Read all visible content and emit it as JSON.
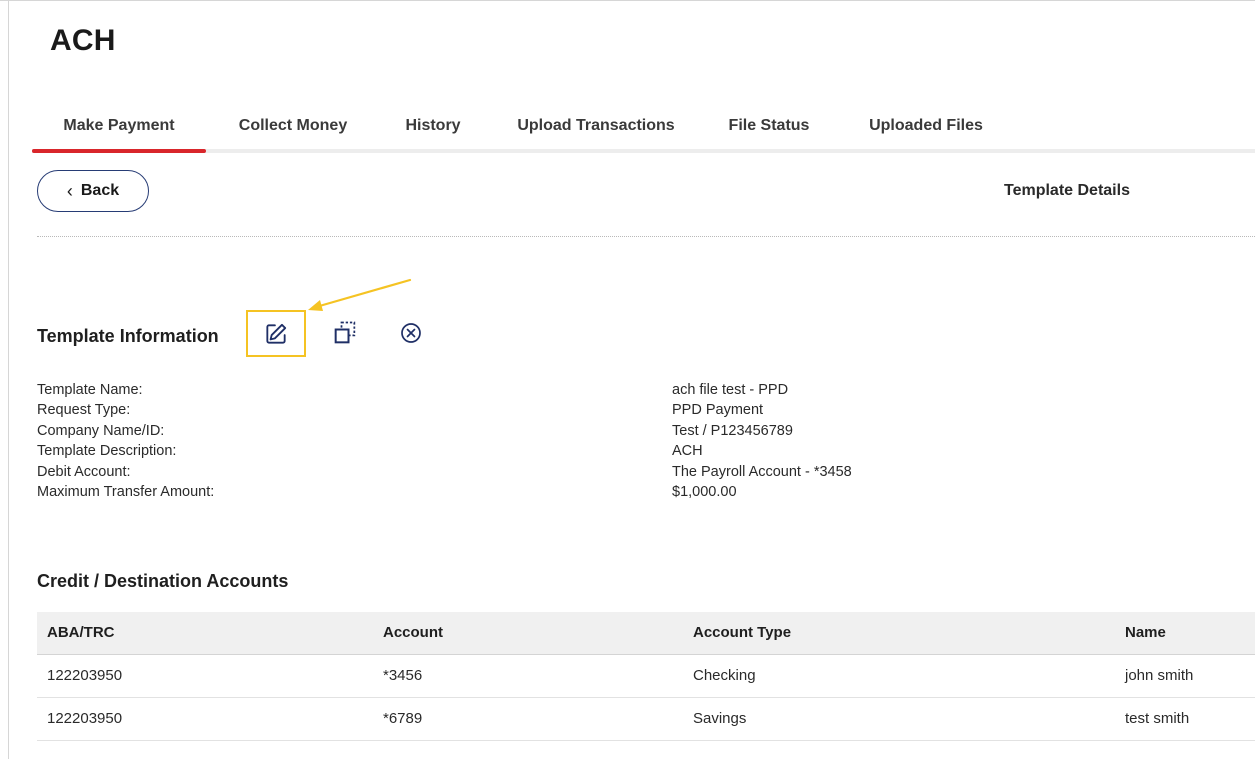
{
  "page": {
    "title": "ACH"
  },
  "tabs": [
    {
      "label": "Make Payment",
      "active": true
    },
    {
      "label": "Collect Money"
    },
    {
      "label": "History"
    },
    {
      "label": "Upload Transactions"
    },
    {
      "label": "File Status"
    },
    {
      "label": "Uploaded Files"
    }
  ],
  "toolbar": {
    "back_label": "Back",
    "back_icon": "chevron-left-icon",
    "right_label": "Template Details"
  },
  "template_info": {
    "title": "Template Information",
    "actions": [
      {
        "icon": "edit-icon",
        "highlighted": true
      },
      {
        "icon": "copy-icon"
      },
      {
        "icon": "cancel-circle-icon"
      }
    ],
    "fields": [
      {
        "label": "Template Name:",
        "value": "ach file test - PPD"
      },
      {
        "label": "Request Type:",
        "value": "PPD Payment"
      },
      {
        "label": "Company Name/ID:",
        "value": "Test / P123456789"
      },
      {
        "label": "Template Description:",
        "value": "ACH"
      },
      {
        "label": "Debit Account:",
        "value": "The Payroll Account - *3458"
      },
      {
        "label": "Maximum Transfer Amount:",
        "value": "$1,000.00"
      }
    ]
  },
  "accounts": {
    "title": "Credit / Destination Accounts",
    "columns": [
      "ABA/TRC",
      "Account",
      "Account Type",
      "Name"
    ],
    "rows": [
      [
        "122203950",
        "*3456",
        "Checking",
        "john smith"
      ],
      [
        "122203950",
        "*6789",
        "Savings",
        "test smith"
      ]
    ]
  },
  "colors": {
    "accent": "#d9262b",
    "highlight": "#f5c323",
    "button_border": "#273c75",
    "icon": "#1f2f66"
  }
}
